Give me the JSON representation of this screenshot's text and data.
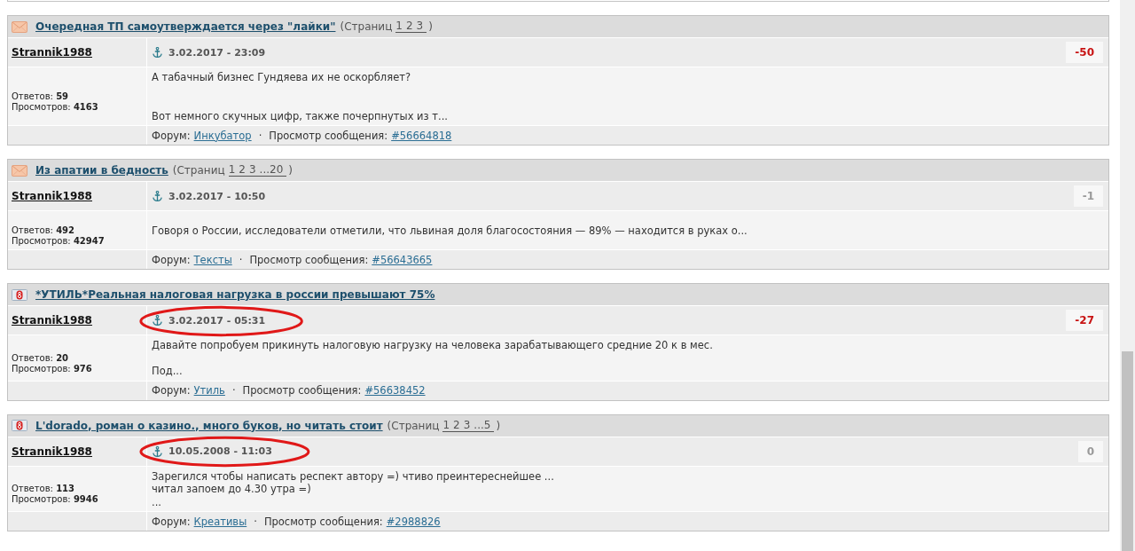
{
  "posts": [
    {
      "topic": {
        "kind": "normal",
        "title": "Очередная ТП самоутверждается через \"лайки\"",
        "pages_label": "(Страниц",
        "pages": [
          "1",
          "2",
          "3"
        ],
        "pages_close": ")"
      },
      "author": "Strannik1988",
      "date": "3.02.2017 - 23:09",
      "circled": false,
      "score": {
        "value": "-50",
        "color": "#c81414"
      },
      "stats": [
        "Ответов: **59**",
        "Просмотров: **4163**"
      ],
      "preview": "А табачный бизнес Гундяева их не оскорбляет?\n\n\nВот немного скучных цифр, также почерпнутых из т...",
      "footer": {
        "forum_label": "Форум:",
        "forum": "Инкубатор",
        "separator": "·",
        "message_label": "Просмотр сообщения:",
        "message": "#56664818"
      }
    },
    {
      "topic": {
        "kind": "normal",
        "title": "Из апатии в бедность",
        "pages_label": "(Страниц",
        "pages": [
          "1",
          "2",
          "3",
          "...20"
        ],
        "pages_close": ")"
      },
      "author": "Strannik1988",
      "date": "3.02.2017 - 10:50",
      "circled": false,
      "score": {
        "value": "-1",
        "color": "#999999"
      },
      "stats": [
        "Ответов: **492**",
        "Просмотров: **42947**"
      ],
      "preview": "Говоря о России, исследователи отметили, что львиная доля благосостояния — 89% — находится в руках о...",
      "footer": {
        "forum_label": "Форум:",
        "forum": "Тексты",
        "separator": "·",
        "message_label": "Просмотр сообщения:",
        "message": "#56643665"
      }
    },
    {
      "topic": {
        "kind": "flagged",
        "title": "*УТИЛЬ*Реальная налоговая нагрузка в россии превышают 75%"
      },
      "author": "Strannik1988",
      "date": "3.02.2017 - 05:31",
      "circled": true,
      "score": {
        "value": "-27",
        "color": "#c81414"
      },
      "stats": [
        "Ответов: **20**",
        "Просмотров: **976**"
      ],
      "preview": "Давайте попробуем прикинуть налоговую нагрузку на человека зарабатывающего средние 20 к в мес.\n\nПод...",
      "footer": {
        "forum_label": "Форум:",
        "forum": "Утиль",
        "separator": "·",
        "message_label": "Просмотр сообщения:",
        "message": "#56638452"
      }
    },
    {
      "topic": {
        "kind": "flagged",
        "title": "L'dorado, роман о казино., много буков, но читать стоит",
        "pages_label": "(Страниц",
        "pages": [
          "1",
          "2",
          "3",
          "...5"
        ],
        "pages_close": ")"
      },
      "author": "Strannik1988",
      "date": "10.05.2008 - 11:03",
      "circled": true,
      "score": {
        "value": "0",
        "color": "#999999"
      },
      "stats": [
        "Ответов: **113**",
        "Просмотров: **9946**"
      ],
      "preview": "Зарегился чтобы написать респект автору =) чтиво преинтереснейшее ...\nчитал запоем до 4.30 утра =)\n...",
      "footer": {
        "forum_label": "Форум:",
        "forum": "Креативы",
        "separator": "·",
        "message_label": "Просмотр сообщения:",
        "message": "#2988826"
      }
    }
  ]
}
